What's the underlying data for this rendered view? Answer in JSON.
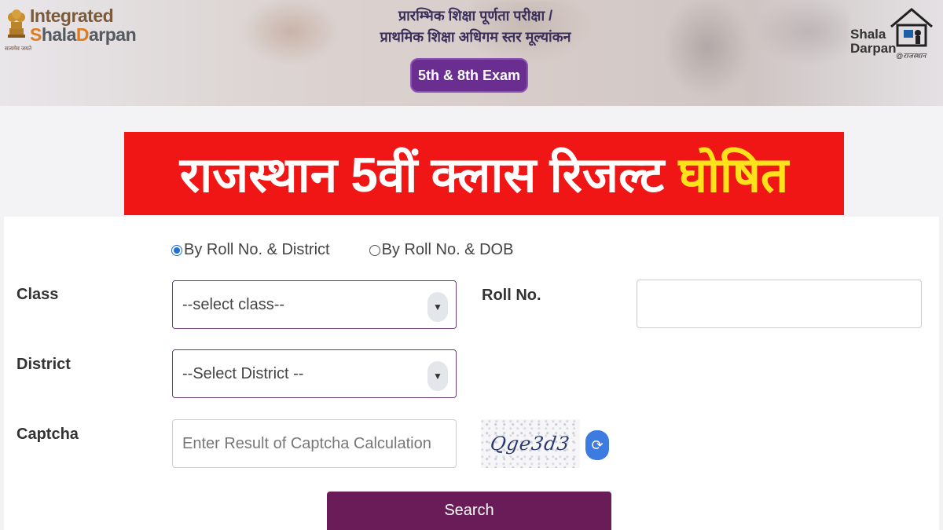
{
  "header": {
    "emblem_caption": "सत्यमेव जयते",
    "logo_left_line1": "Integrated",
    "logo_left_line2_a": "S",
    "logo_left_line2_b": "hala",
    "logo_left_line2_c": "D",
    "logo_left_line2_d": "arpan",
    "hindi_line1": "प्रारम्भिक शिक्षा पूर्णता परीक्षा /",
    "hindi_line2": "प्राथमिक शिक्षा अधिगम स्तर मूल्यांकन",
    "exam_pill": "5th & 8th Exam",
    "logo_right_line1": "Shala",
    "logo_right_line2": "Darpan",
    "logo_right_tag": "@राजस्थान"
  },
  "banner": {
    "white_text": "राजस्थान 5वीं क्लास रिजल्ट",
    "yellow_text": "घोषित"
  },
  "form": {
    "radio_options": [
      {
        "label": "By Roll No. & District",
        "selected": true
      },
      {
        "label": "By Roll No. & DOB",
        "selected": false
      }
    ],
    "class_label": "Class",
    "class_select_value": "--select class--",
    "roll_label": "Roll No.",
    "roll_value": "",
    "district_label": "District",
    "district_select_value": "--Select District --",
    "captcha_label": "Captcha",
    "captcha_placeholder": "Enter Result of Captcha Calculation",
    "captcha_text": "Qge3d3",
    "search_label": "Search"
  },
  "colors": {
    "banner_red": "#f01616",
    "banner_yellow": "#ffe21a",
    "exam_pill": "#6a2e91",
    "search_button": "#6a1c58",
    "radio_selected": "#1e6fd9",
    "refresh_button": "#3d7be0"
  },
  "icons": {
    "emblem": "state-emblem-icon",
    "house_logo": "school-house-icon",
    "select_caret": "caret-down-icon",
    "refresh": "refresh-icon"
  }
}
